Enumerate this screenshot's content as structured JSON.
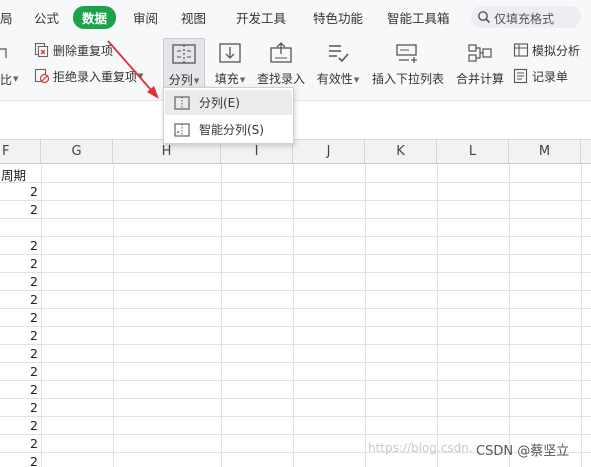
{
  "menubar": {
    "tabs": [
      {
        "label": "局"
      },
      {
        "label": "公式"
      },
      {
        "label": "数据",
        "active": true
      },
      {
        "label": "审阅"
      },
      {
        "label": "视图"
      },
      {
        "label": "开发工具"
      },
      {
        "label": "特色功能"
      },
      {
        "label": "智能工具箱"
      }
    ],
    "search_text": "仅填充格式"
  },
  "ribbon": {
    "delete_duplicates": "删除重复项",
    "reject_duplicates": "拒绝录入重复项",
    "compare_cut": "比",
    "split_column": "分列",
    "fill": "填充",
    "lookup_entry": "查找录入",
    "validity": "有效性",
    "insert_dropdown": "插入下拉列表",
    "merge_calc": "合并计算",
    "simulate_analysis": "模拟分析",
    "record_sheet": "记录单"
  },
  "dropdown": {
    "items": [
      {
        "label": "分列(E)"
      },
      {
        "label": "智能分列(S)"
      }
    ]
  },
  "grid": {
    "columns": [
      "F",
      "G",
      "H",
      "I",
      "J",
      "K",
      "L",
      "M"
    ],
    "f_header_text": "周期",
    "f_values": [
      "2",
      "2",
      "",
      "2",
      "2",
      "2",
      "2",
      "2",
      "2",
      "2",
      "2",
      "2",
      "2",
      "2",
      "2",
      "2",
      "2"
    ]
  },
  "watermark": "https://blog.csdn.",
  "credit": "CSDN @蔡坚立",
  "colors": {
    "active_tab": "#1fa34a",
    "arrow": "#e03030"
  }
}
